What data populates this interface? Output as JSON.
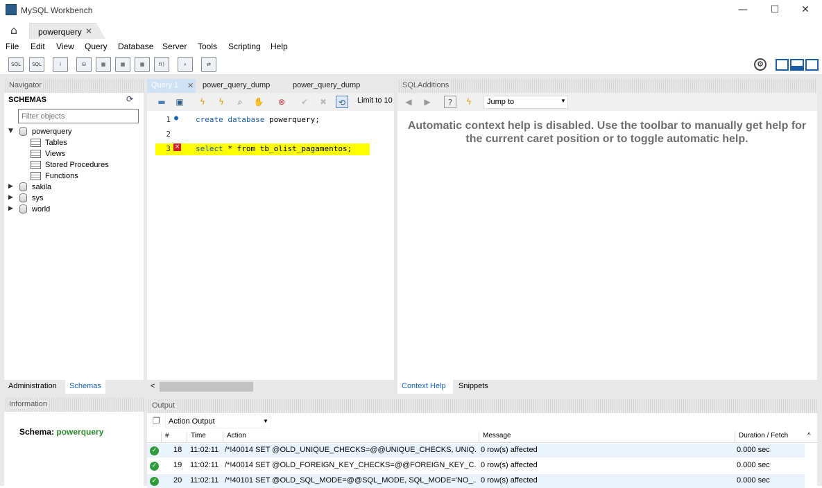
{
  "window": {
    "title": "MySQL Workbench",
    "minimize": "—",
    "maximize": "☐",
    "close": "✕"
  },
  "tabs": {
    "connection": "powerquery"
  },
  "menu": [
    "File",
    "Edit",
    "View",
    "Query",
    "Database",
    "Server",
    "Tools",
    "Scripting",
    "Help"
  ],
  "navigator": {
    "header": "Navigator",
    "schemas_label": "SCHEMAS",
    "filter_placeholder": "Filter objects",
    "tree": {
      "db": "powerquery",
      "children": [
        "Tables",
        "Views",
        "Stored Procedures",
        "Functions"
      ],
      "others": [
        "sakila",
        "sys",
        "world"
      ]
    },
    "tabs": {
      "admin": "Administration",
      "schemas": "Schemas"
    }
  },
  "information": {
    "header": "Information",
    "schema_label": "Schema:",
    "schema_value": "powerquery"
  },
  "editor": {
    "tabs": [
      "Query 1",
      "power_query_dump",
      "power_query_dump"
    ],
    "limit": "Limit to 10",
    "lines": [
      {
        "num": "1",
        "kw": "create database",
        "rest": " powerquery;"
      },
      {
        "num": "2",
        "kw": "",
        "rest": ""
      },
      {
        "num": "3",
        "kw": "select",
        "rest": " * from tb_olist_pagamentos;"
      }
    ]
  },
  "sql_additions": {
    "header": "SQLAdditions",
    "jump_to": "Jump to",
    "help_text": "Automatic context help is disabled. Use the toolbar to manually get help for the current caret position or to toggle automatic help.",
    "tabs": {
      "context": "Context Help",
      "snippets": "Snippets"
    }
  },
  "output": {
    "header": "Output",
    "selector": "Action Output",
    "columns": [
      "#",
      "Time",
      "Action",
      "Message",
      "Duration / Fetch"
    ],
    "rows": [
      {
        "num": "18",
        "time": "11:02:11",
        "action": "/*!40014 SET @OLD_UNIQUE_CHECKS=@@UNIQUE_CHECKS, UNIQ...",
        "message": "0 row(s) affected",
        "duration": "0.000 sec"
      },
      {
        "num": "19",
        "time": "11:02:11",
        "action": "/*!40014 SET @OLD_FOREIGN_KEY_CHECKS=@@FOREIGN_KEY_C...",
        "message": "0 row(s) affected",
        "duration": "0.000 sec"
      },
      {
        "num": "20",
        "time": "11:02:11",
        "action": "/*!40101 SET @OLD_SQL_MODE=@@SQL_MODE, SQL_MODE='NO_...",
        "message": "0 row(s) affected",
        "duration": "0.000 sec"
      }
    ]
  },
  "toolbar_icons": [
    "new-sql-tab-icon",
    "open-sql-file-icon",
    "inspector-icon",
    "create-schema-icon",
    "create-table-icon",
    "create-view-icon",
    "create-procedure-icon",
    "create-function-icon",
    "search-table-icon",
    "reconnect-icon"
  ],
  "colors": {
    "accent": "#1a64b6",
    "highlight": "#fcff00",
    "success": "#2e9c3c"
  }
}
